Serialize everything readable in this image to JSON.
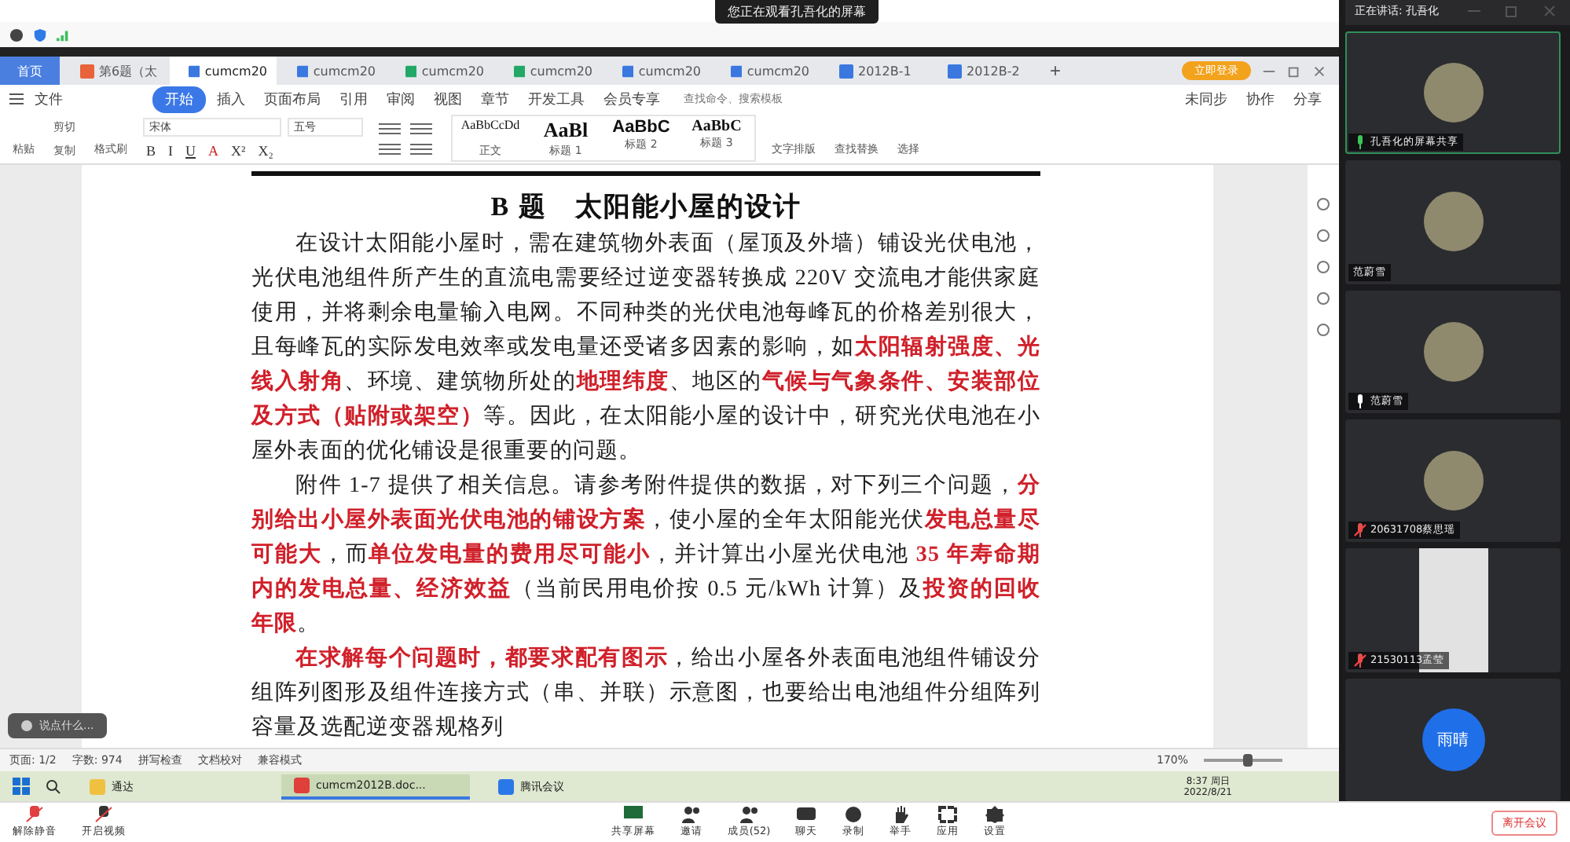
{
  "viewer_banner": {
    "text": "您正在观看孔吾化的屏幕"
  },
  "tabs": [
    {
      "label": "首页",
      "kind": "home",
      "selected": false
    },
    {
      "label": "第6题（太",
      "kind": "ppt",
      "selected": false
    },
    {
      "label": "cumcm20",
      "kind": "word",
      "selected": true
    },
    {
      "label": "cumcm20",
      "kind": "word",
      "selected": false
    },
    {
      "label": "cumcm20",
      "kind": "sheet",
      "selected": false
    },
    {
      "label": "cumcm20",
      "kind": "sheet",
      "selected": false
    },
    {
      "label": "cumcm20",
      "kind": "word",
      "selected": false
    },
    {
      "label": "cumcm20",
      "kind": "word",
      "selected": false
    },
    {
      "label": "2012B-1",
      "kind": "word",
      "selected": false
    },
    {
      "label": "2012B-2",
      "kind": "word",
      "selected": false
    }
  ],
  "new_tab": "+",
  "login_button": "立即登录",
  "menu": {
    "file": "文件",
    "items": [
      {
        "label": "开始",
        "selected": true
      },
      {
        "label": "插入",
        "selected": false
      },
      {
        "label": "页面布局",
        "selected": false
      },
      {
        "label": "引用",
        "selected": false
      },
      {
        "label": "审阅",
        "selected": false
      },
      {
        "label": "视图",
        "selected": false
      },
      {
        "label": "章节",
        "selected": false
      },
      {
        "label": "开发工具",
        "selected": false
      },
      {
        "label": "会员专享",
        "selected": false
      }
    ],
    "search_placeholder": "查找命令、搜索模板",
    "actions": [
      "未同步",
      "协作",
      "分享"
    ]
  },
  "ribbon": {
    "paste": "粘贴",
    "cut": "剪切",
    "copy": "复制",
    "format_painter": "格式刷",
    "font": "宋体",
    "size": "五号",
    "format_marks": [
      "B",
      "I",
      "U",
      "A",
      "X²",
      "X₂"
    ],
    "styles": [
      {
        "sample": "AaBbCcDd",
        "label": "正文",
        "kind": "body"
      },
      {
        "sample": "AaBl",
        "label": "标题 1",
        "kind": "h1"
      },
      {
        "sample": "AaBbC",
        "label": "标题 2",
        "kind": "h2"
      },
      {
        "sample": "AaBbC",
        "label": "标题 3",
        "kind": "h3"
      }
    ],
    "tools": [
      "文字排版",
      "查找替换",
      "选择"
    ]
  },
  "document": {
    "title": "B 题　太阳能小屋的设计",
    "paragraphs": [
      "在设计太阳能小屋时，需在建筑物外表面（屋顶及外墙）铺设光伏电池，光伏电池组件所产生的直流电需要经过逆变器转换成 220V 交流电才能供家庭使用，并将剩余电量输入电网。不同种类的光伏电池每峰瓦的价格差别很大，且每峰瓦的实际发电效率或发电量还受诸多因素的影响，如**太阳辐射强度、光线入射角**、环境、建筑物所处的**地理纬度**、地区的**气候与气象条件、安装部位及方式（贴附或架空）**等。因此，在太阳能小屋的设计中，研究光伏电池在小屋外表面的优化铺设是很重要的问题。",
      "附件 1-7 提供了相关信息。请参考附件提供的数据，对下列三个问题，**分别给出小屋外表面光伏电池的铺设方案**，使小屋的全年太阳能光伏**发电总量尽可能大**，而**单位发电量的费用尽可能小**，并计算出小屋光伏电池 **35 年寿命期内的发电总量、经济效益**（当前民用电价按 0.5 元/kWh 计算）及**投资的回收年限**。",
      "**在求解每个问题时，都要求配有图示**，给出小屋各外表面电池组件铺设分组阵列图形及组件连接方式（串、并联）示意图，也要给出电池组件分组阵列容量及选配逆变器规格列"
    ]
  },
  "comment_box": {
    "placeholder": "说点什么..."
  },
  "status_bar": {
    "items": [
      "页面: 1/2",
      "字数: 974",
      "拼写检查",
      "文档校对",
      "兼容模式"
    ],
    "zoom": "170%",
    "level": 0.55
  },
  "taskbar": {
    "apps": [
      {
        "label": "通达",
        "kind": "folder",
        "selected": false
      },
      {
        "label": "cumcm2012B.doc...",
        "kind": "wps",
        "selected": true
      },
      {
        "label": "腾讯会议",
        "kind": "meeting",
        "selected": false
      }
    ],
    "time": "8:37 周日",
    "date": "2022/8/21"
  },
  "meeting_toolbar": {
    "left": [
      {
        "label": "解除静音",
        "kind": "mic"
      },
      {
        "label": "开启视频",
        "kind": "camera"
      }
    ],
    "center": [
      {
        "label": "共享屏幕",
        "kind": "share"
      },
      {
        "label": "邀请",
        "kind": "invite"
      },
      {
        "label": "成员(52)",
        "kind": "members"
      },
      {
        "label": "聊天",
        "kind": "chat"
      },
      {
        "label": "录制",
        "kind": "record"
      },
      {
        "label": "举手",
        "kind": "hand"
      },
      {
        "label": "应用",
        "kind": "apps"
      },
      {
        "label": "设置",
        "kind": "settings"
      }
    ],
    "leave": "离开会议"
  },
  "speaker_panel": {
    "speaking": "正在讲话: 孔吾化",
    "participants": [
      {
        "name": "孔吾化的屏幕共享",
        "kind": "avatar",
        "mic_icon": true,
        "talking": true,
        "muted": false
      },
      {
        "name": "范蔚雪",
        "kind": "avatar",
        "mic_icon": false,
        "talking": false,
        "muted": false
      },
      {
        "name": "范蔚雪",
        "kind": "avatar",
        "mic_icon": true,
        "talking": false,
        "muted": false
      },
      {
        "name": "20631708蔡思瑶",
        "kind": "avatar",
        "mic_icon": true,
        "talking": false,
        "muted": true
      },
      {
        "name": "21530113孟莹",
        "kind": "video",
        "mic_icon": true,
        "talking": false,
        "muted": true
      },
      {
        "name": "雨晴",
        "kind": "initials",
        "mic_icon": false,
        "talking": false,
        "muted": false
      }
    ]
  }
}
